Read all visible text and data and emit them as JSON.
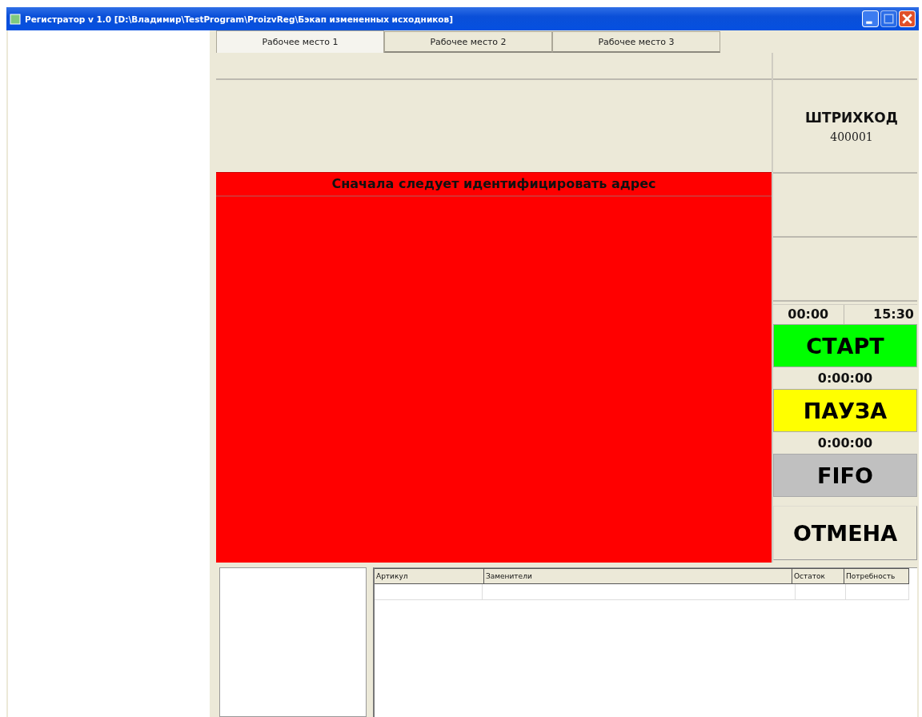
{
  "window": {
    "title": "Регистратор v 1.0  [D:\\Владимир\\TestProgram\\ProizvReg\\Бэкап измененных исходников]"
  },
  "tabs": [
    {
      "label": "Рабочее место 1",
      "selected": true
    },
    {
      "label": "Рабочее место 2",
      "selected": false
    },
    {
      "label": "Рабочее место 3",
      "selected": false
    }
  ],
  "message": "Сначала следует идентифицировать адрес",
  "barcode": {
    "label": "ШТРИХКОД",
    "value": "400001"
  },
  "times": [
    "00:00",
    "15:30"
  ],
  "controls": [
    {
      "kind": "button",
      "label": "СТАРТ",
      "color": "#00ff00"
    },
    {
      "kind": "timer",
      "text": "0:00:00"
    },
    {
      "kind": "button",
      "label": "ПАУЗА",
      "color": "#ffff00"
    },
    {
      "kind": "timer",
      "text": "0:00:00"
    },
    {
      "kind": "button",
      "label": "FIFO",
      "color": "#c0c0c0"
    },
    {
      "kind": "raised",
      "label": "ОТМЕНА"
    }
  ],
  "table": {
    "columns": [
      "Артикул",
      "Заменители",
      "Остаток",
      "Потребность"
    ]
  }
}
